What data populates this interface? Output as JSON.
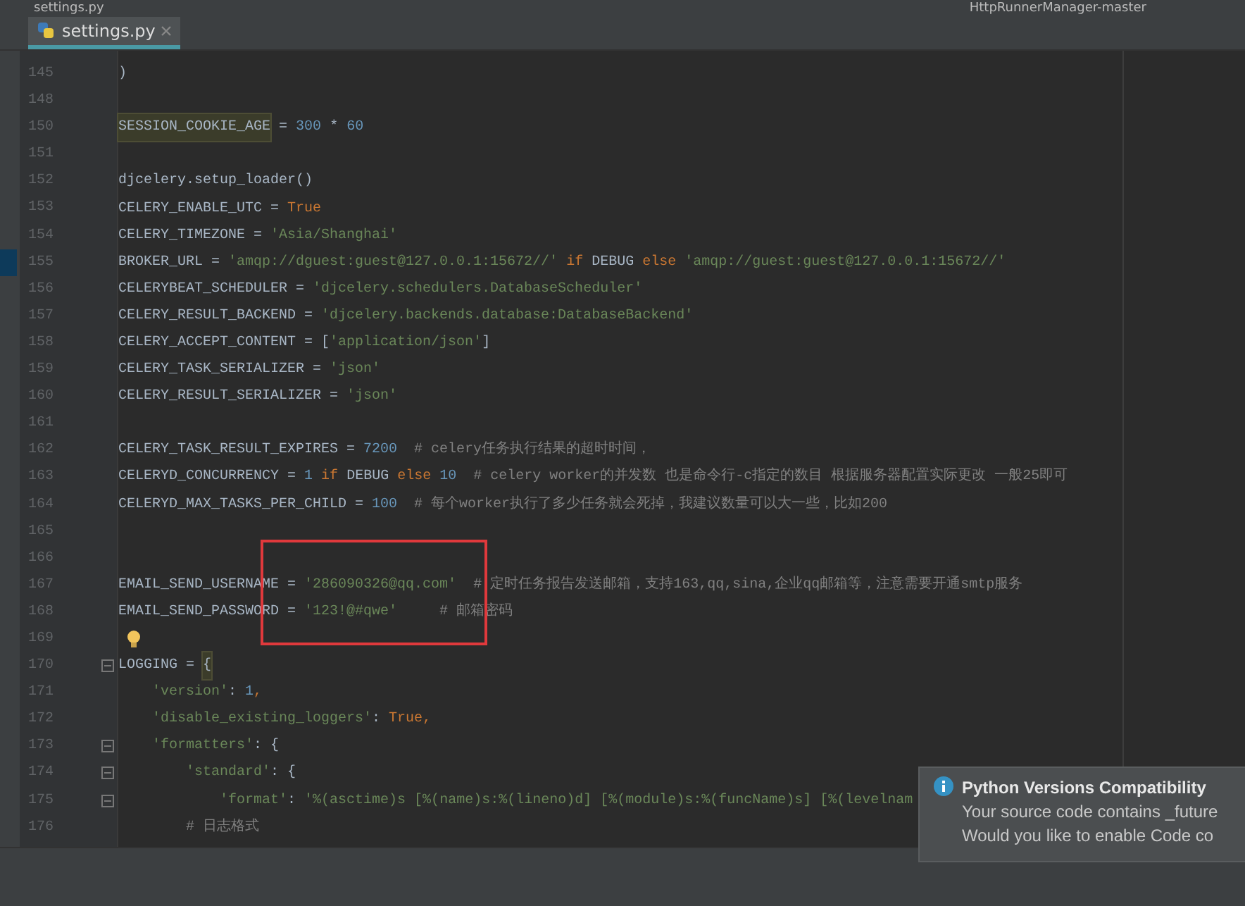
{
  "window": {
    "title": "settings.py",
    "run_config": "HttpRunnerManager-master"
  },
  "tabs": [
    {
      "label": "settings.py",
      "selected": true
    }
  ],
  "editor": {
    "lines": [
      {
        "number": "145",
        "tokens": [
          {
            "text": ")",
            "kind": "plain"
          }
        ]
      },
      {
        "number": "148"
      },
      {
        "number": "150",
        "tokens": [
          {
            "text": "SESSION_COOKIE_AGE",
            "kind": "highlight"
          },
          {
            "text": " = ",
            "kind": "plain"
          },
          {
            "text": "300",
            "kind": "number"
          },
          {
            "text": " * ",
            "kind": "plain"
          },
          {
            "text": "60",
            "kind": "number"
          }
        ]
      },
      {
        "number": "151"
      },
      {
        "number": "152",
        "tokens": [
          {
            "text": "djcelery.setup_loader()",
            "kind": "plain"
          }
        ]
      },
      {
        "number": "153",
        "tokens": [
          {
            "text": "CELERY_ENABLE_UTC = ",
            "kind": "plain"
          },
          {
            "text": "True",
            "kind": "keyword"
          }
        ]
      },
      {
        "number": "154",
        "tokens": [
          {
            "text": "CELERY_TIMEZONE = ",
            "kind": "plain"
          },
          {
            "text": "'Asia/Shanghai'",
            "kind": "string"
          }
        ]
      },
      {
        "number": "155",
        "bookmarked": true,
        "tokens": [
          {
            "text": "BROKER_URL = ",
            "kind": "plain"
          },
          {
            "text": "'amqp://dguest:guest@127.0.0.1:15672//'",
            "kind": "string"
          },
          {
            "text": " if",
            "kind": "keyword"
          },
          {
            "text": " DEBUG ",
            "kind": "plain"
          },
          {
            "text": "else",
            "kind": "keyword"
          },
          {
            "text": " 'amqp://guest:guest@127.0.0.1:15672//'",
            "kind": "string"
          }
        ]
      },
      {
        "number": "156",
        "tokens": [
          {
            "text": "CELERYBEAT_SCHEDULER = ",
            "kind": "plain"
          },
          {
            "text": "'djcelery.schedulers.DatabaseScheduler'",
            "kind": "string"
          }
        ]
      },
      {
        "number": "157",
        "tokens": [
          {
            "text": "CELERY_RESULT_BACKEND = ",
            "kind": "plain"
          },
          {
            "text": "'djcelery.backends.database:DatabaseBackend'",
            "kind": "string"
          }
        ]
      },
      {
        "number": "158",
        "tokens": [
          {
            "text": "CELERY_ACCEPT_CONTENT = [",
            "kind": "plain"
          },
          {
            "text": "'application/json'",
            "kind": "string"
          },
          {
            "text": "]",
            "kind": "plain"
          }
        ]
      },
      {
        "number": "159",
        "tokens": [
          {
            "text": "CELERY_TASK_SERIALIZER = ",
            "kind": "plain"
          },
          {
            "text": "'json'",
            "kind": "string"
          }
        ]
      },
      {
        "number": "160",
        "tokens": [
          {
            "text": "CELERY_RESULT_SERIALIZER = ",
            "kind": "plain"
          },
          {
            "text": "'json'",
            "kind": "string"
          }
        ]
      },
      {
        "number": "161"
      },
      {
        "number": "162",
        "tokens": [
          {
            "text": "CELERY_TASK_RESULT_EXPIRES = ",
            "kind": "plain"
          },
          {
            "text": "7200",
            "kind": "number"
          },
          {
            "text": "  # celery任务执行结果的超时时间，",
            "kind": "comment"
          }
        ]
      },
      {
        "number": "163",
        "tokens": [
          {
            "text": "CELERYD_CONCURRENCY = ",
            "kind": "plain"
          },
          {
            "text": "1",
            "kind": "number"
          },
          {
            "text": " if",
            "kind": "keyword"
          },
          {
            "text": " DEBUG ",
            "kind": "plain"
          },
          {
            "text": "else",
            "kind": "keyword"
          },
          {
            "text": " 10",
            "kind": "number"
          },
          {
            "text": "  # celery worker的并发数 也是命令行-c指定的数目 根据服务器配置实际更改 一般25即可",
            "kind": "comment"
          }
        ]
      },
      {
        "number": "164",
        "tokens": [
          {
            "text": "CELERYD_MAX_TASKS_PER_CHILD = ",
            "kind": "plain"
          },
          {
            "text": "100",
            "kind": "number"
          },
          {
            "text": "  # 每个worker执行了多少任务就会死掉，我建议数量可以大一些，比如200",
            "kind": "comment"
          }
        ]
      },
      {
        "number": "165"
      },
      {
        "number": "166"
      },
      {
        "number": "167",
        "tokens": [
          {
            "text": "EMAIL_SEND_USERNAME = ",
            "kind": "plain"
          },
          {
            "text": "'286090326@qq.com'",
            "kind": "string"
          },
          {
            "text": "  # 定时任务报告发送邮箱，支持163,qq,sina,企业qq邮箱等，注意需要开通smtp服务",
            "kind": "comment"
          }
        ]
      },
      {
        "number": "168",
        "tokens": [
          {
            "text": "EMAIL_SEND_PASSWORD = ",
            "kind": "plain"
          },
          {
            "text": "'123!@#qwe'",
            "kind": "string"
          },
          {
            "text": "     # 邮箱密码",
            "kind": "comment"
          }
        ]
      },
      {
        "number": "169",
        "bulb": true
      },
      {
        "number": "170",
        "fold": true,
        "tokens": [
          {
            "text": "LOGGING = ",
            "kind": "plain"
          },
          {
            "text": "{",
            "kind": "highlight"
          }
        ]
      },
      {
        "number": "171",
        "tokens": [
          {
            "text": "    'version'",
            "kind": "string"
          },
          {
            "text": ": ",
            "kind": "plain"
          },
          {
            "text": "1",
            "kind": "number"
          },
          {
            "text": ",",
            "kind": "keyword"
          }
        ]
      },
      {
        "number": "172",
        "tokens": [
          {
            "text": "    'disable_existing_loggers'",
            "kind": "string"
          },
          {
            "text": ": ",
            "kind": "plain"
          },
          {
            "text": "True",
            "kind": "keyword"
          },
          {
            "text": ",",
            "kind": "keyword"
          }
        ]
      },
      {
        "number": "173",
        "fold": true,
        "tokens": [
          {
            "text": "    'formatters'",
            "kind": "string"
          },
          {
            "text": ": {",
            "kind": "plain"
          }
        ]
      },
      {
        "number": "174",
        "fold": true,
        "tokens": [
          {
            "text": "        'standard'",
            "kind": "string"
          },
          {
            "text": ": {",
            "kind": "plain"
          }
        ]
      },
      {
        "number": "175",
        "fold": true,
        "tokens": [
          {
            "text": "            'format'",
            "kind": "string"
          },
          {
            "text": ": ",
            "kind": "plain"
          },
          {
            "text": "'%(asctime)s [%(name)s:%(lineno)d] [%(module)s:%(funcName)s] [%(levelnam",
            "kind": "string"
          }
        ]
      },
      {
        "number": "176",
        "tokens": [
          {
            "text": "        # 日志格式",
            "kind": "comment"
          }
        ]
      }
    ]
  },
  "notification": {
    "title": "Python Versions Compatibility",
    "lines": [
      "Your source code contains _future",
      "Would you like to enable Code co"
    ]
  }
}
